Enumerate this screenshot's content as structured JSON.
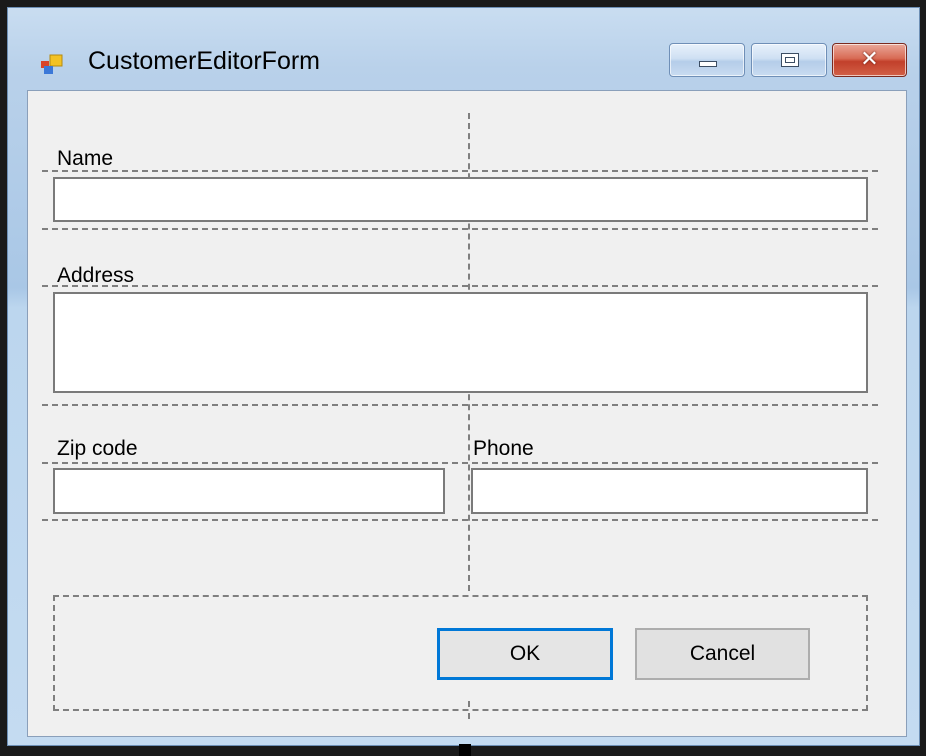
{
  "window": {
    "title": "CustomerEditorForm",
    "icon": "winforms-form-icon",
    "controls": {
      "minimize": "minimize-icon",
      "maximize": "maximize-icon",
      "close": "close-icon"
    }
  },
  "form": {
    "name_label": "Name",
    "name_value": "",
    "address_label": "Address",
    "address_value": "",
    "zip_label": "Zip code",
    "zip_value": "",
    "phone_label": "Phone",
    "phone_value": ""
  },
  "buttons": {
    "ok_label": "OK",
    "cancel_label": "Cancel"
  },
  "colors": {
    "client_background": "#f0f0f0",
    "ok_focus_border": "#0078d7",
    "close_button": "#c2402b"
  }
}
